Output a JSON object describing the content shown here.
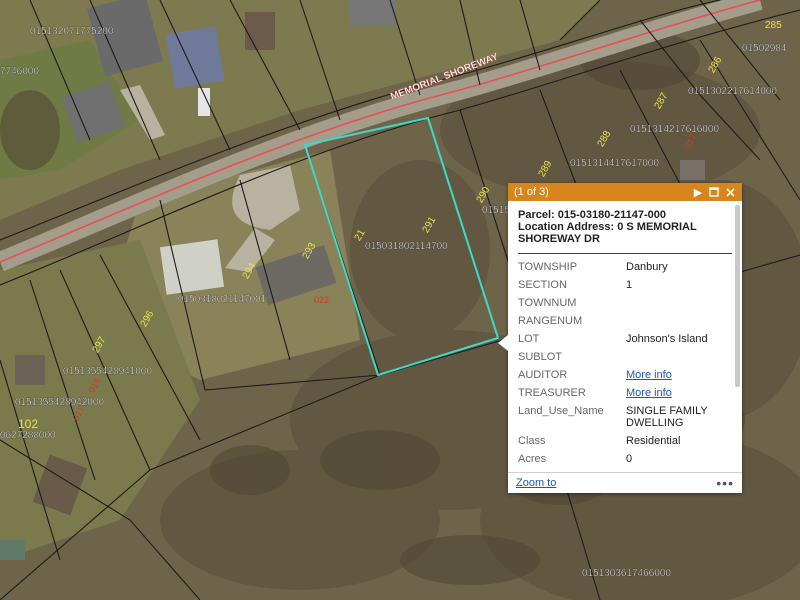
{
  "map": {
    "road_label": "MEMORIAL SHOREWAY",
    "parcel_ids": [
      "015132071775200",
      "01502984",
      "0151302217614000",
      "0151314217616000",
      "0151314417617000",
      "01515",
      "015031802114700",
      "015031802114700",
      "0151355428941000",
      "0151355428942000",
      "0151303617466000",
      "0627288000",
      "7746000"
    ],
    "house_numbers": [
      "285",
      "286",
      "287",
      "288",
      "289",
      "290",
      "291",
      "293",
      "294",
      "296",
      "297",
      "102",
      "21"
    ],
    "red_numbers": [
      "022",
      "017",
      "016",
      "017"
    ],
    "colors": {
      "selected_parcel": "#3fd9c8",
      "road_line": "#e65050",
      "parcel_lines": "#1c1c1c",
      "parcel_id_text": "#ffffff",
      "house_number_text": "#e8e050"
    }
  },
  "popup": {
    "count": "(1 of 3)",
    "header_color": "#d7851d",
    "buttons": {
      "next_icon": "play-icon",
      "maximize_icon": "maximize-icon",
      "close_icon": "close-icon"
    },
    "parcel_line": "Parcel: 015-03180-21147-000",
    "address_line1": "Location Address: 0 S MEMORIAL",
    "address_line2": "SHOREWAY DR",
    "attributes": [
      {
        "key": "TOWNSHIP",
        "value": "Danbury"
      },
      {
        "key": "SECTION",
        "value": "1"
      },
      {
        "key": "TOWNNUM",
        "value": ""
      },
      {
        "key": "RANGENUM",
        "value": ""
      },
      {
        "key": "LOT",
        "value": "Johnson's Island"
      },
      {
        "key": "SUBLOT",
        "value": ""
      },
      {
        "key": "AUDITOR",
        "value": "More info",
        "link": true
      },
      {
        "key": "TREASURER",
        "value": "More info",
        "link": true
      },
      {
        "key": "Land_Use_Name",
        "value": "SINGLE FAMILY DWELLING"
      },
      {
        "key": "Class",
        "value": "Residential"
      },
      {
        "key": "Acres",
        "value": "0"
      }
    ],
    "zoom_to": "Zoom to",
    "more": "•••"
  }
}
